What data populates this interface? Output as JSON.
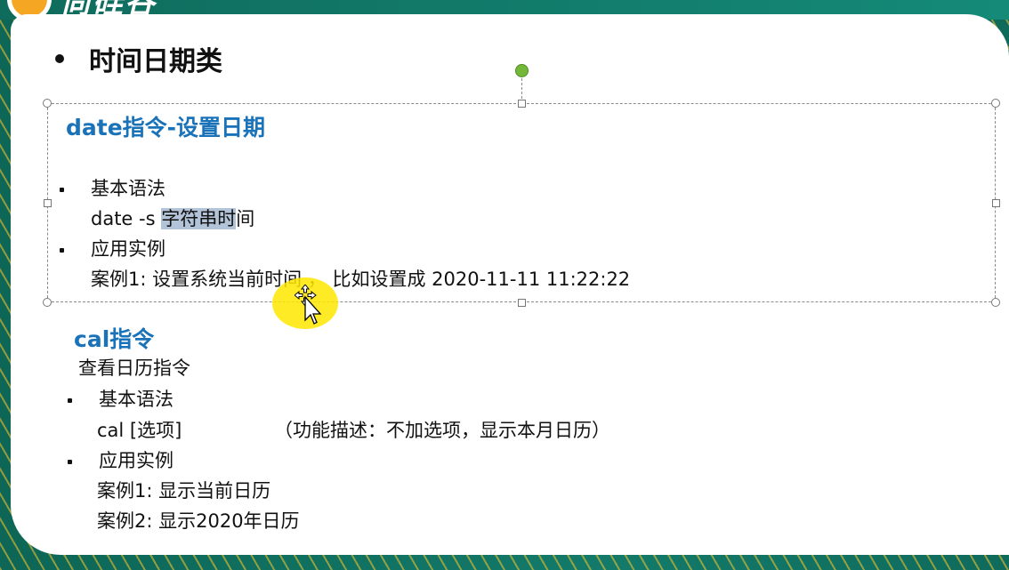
{
  "header": {
    "logo_text": "尚硅谷"
  },
  "slide": {
    "title": "时间日期类",
    "date_section": {
      "heading": "date指令-设置日期",
      "basic_syntax_label": "基本语法",
      "syntax_prefix": "date  -s ",
      "syntax_highlight": "字符串时",
      "syntax_suffix": "间",
      "example_label": "应用实例",
      "example_1": "案例1: 设置系统当前时间 ，  比如设置成 2020-11-11 11:22:22"
    },
    "cal_section": {
      "heading": "cal指令",
      "description": "查看日历指令",
      "basic_syntax_label": "基本语法",
      "syntax": "cal [选项]",
      "syntax_note": "（功能描述：不加选项，显示本月日历）",
      "example_label": "应用实例",
      "example_1": "案例1: 显示当前日历",
      "example_2": "案例2: 显示2020年日历"
    }
  },
  "colors": {
    "heading_blue": "#1a72b8",
    "highlight": "#b3c3d8",
    "rotate_handle": "#74b83a",
    "cursor_halo": "#ffe600"
  }
}
